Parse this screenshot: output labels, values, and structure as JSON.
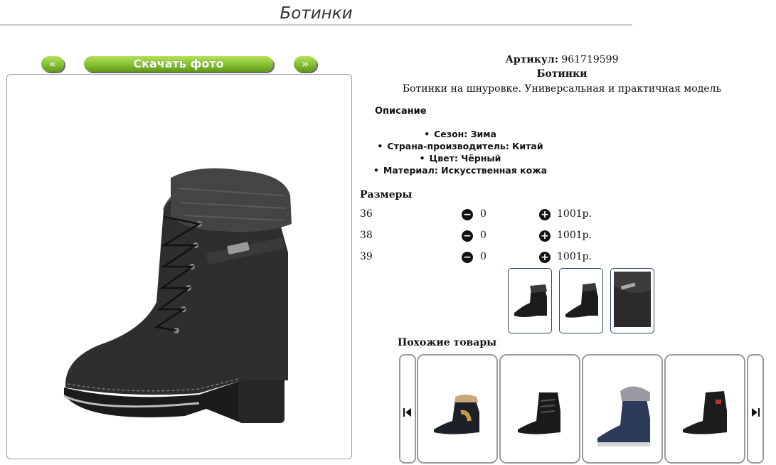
{
  "page_title": "Ботинки",
  "gallery": {
    "prev_label": "«",
    "download_label": "Скачать фото",
    "next_label": "»"
  },
  "product": {
    "article_label": "Артикул:",
    "article_value": "961719599",
    "name": "Ботинки",
    "description": "Ботинки на шнуровке. Универсальная и практичная модель"
  },
  "details": {
    "heading": "Описание",
    "items": [
      "Сезон: Зима",
      "Страна-производитель: Китай",
      "Цвет: Чёрный",
      "Материал: Искусственная кожа"
    ]
  },
  "sizes": {
    "heading": "Размеры",
    "rows": [
      {
        "size": "36",
        "qty": "0",
        "price": "1001р."
      },
      {
        "size": "38",
        "qty": "0",
        "price": "1001р."
      },
      {
        "size": "39",
        "qty": "0",
        "price": "1001р."
      }
    ]
  },
  "similar": {
    "heading": "Похожие товары"
  },
  "colors": {
    "accent_green": "#8cc63a",
    "thumb_border": "#2f4a6a"
  }
}
